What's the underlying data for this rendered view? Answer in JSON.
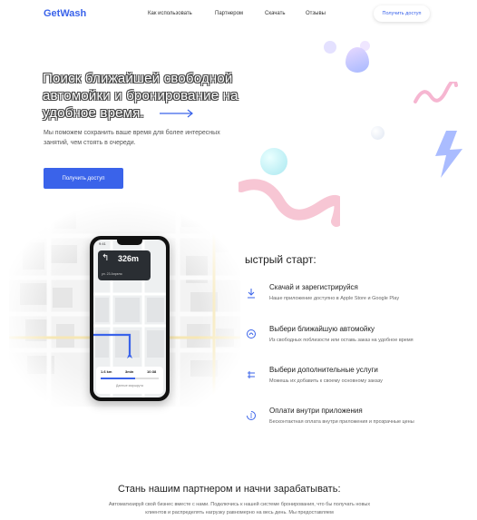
{
  "header": {
    "logo": "GetWash",
    "nav": [
      "Как использовать",
      "Партнером",
      "Скачать",
      "Отзывы"
    ],
    "cta": "Получить доступ"
  },
  "hero": {
    "title": "Поиск ближайшей свободной автомойки и бронирование на удобное время.",
    "subtitle": "Мы поможем сохранить ваше время для более интересных занятий, чем стоять в очереди.",
    "cta": "Получить доступ"
  },
  "phone": {
    "time": "9:41",
    "distance": "326m",
    "street": "ул. 23 Апреля",
    "stats": [
      "1.6 km",
      "3min",
      "10:38"
    ],
    "route_progress": 0.6,
    "bottom_button": "Данные маршрута"
  },
  "quick_start": {
    "title": "ыстрый старт:",
    "steps": [
      {
        "icon": "download-icon",
        "title": "Скачай и зарегистрируйся",
        "desc": "Наше приложение доступно в Apple Store и Google Play"
      },
      {
        "icon": "car-wash-icon",
        "title": "Выбери ближайшую автомойку",
        "desc": "Из свободных поблизости или оставь заказ на удобное время"
      },
      {
        "icon": "services-icon",
        "title": "Выбери дополнительные услуги",
        "desc": "Можешь их добавить к своему основному заказу"
      },
      {
        "icon": "payment-icon",
        "title": "Оплати внутри приложения",
        "desc": "Бесконтактная оплата внутри приложения и прозрачные цены"
      }
    ]
  },
  "partner": {
    "title": "Стань нашим партнером и начни зарабатывать:",
    "text": "Автоматизируй свой бизнес вместе с нами. Подключись к нашей системе бронирования, что бы получать новых клиентов и распределять нагрузку равномерно на весь день. Мы предоставляем"
  },
  "colors": {
    "accent": "#3a63ea",
    "decor_blue": "#c9d6ff",
    "decor_pink": "#f7c6d4"
  }
}
